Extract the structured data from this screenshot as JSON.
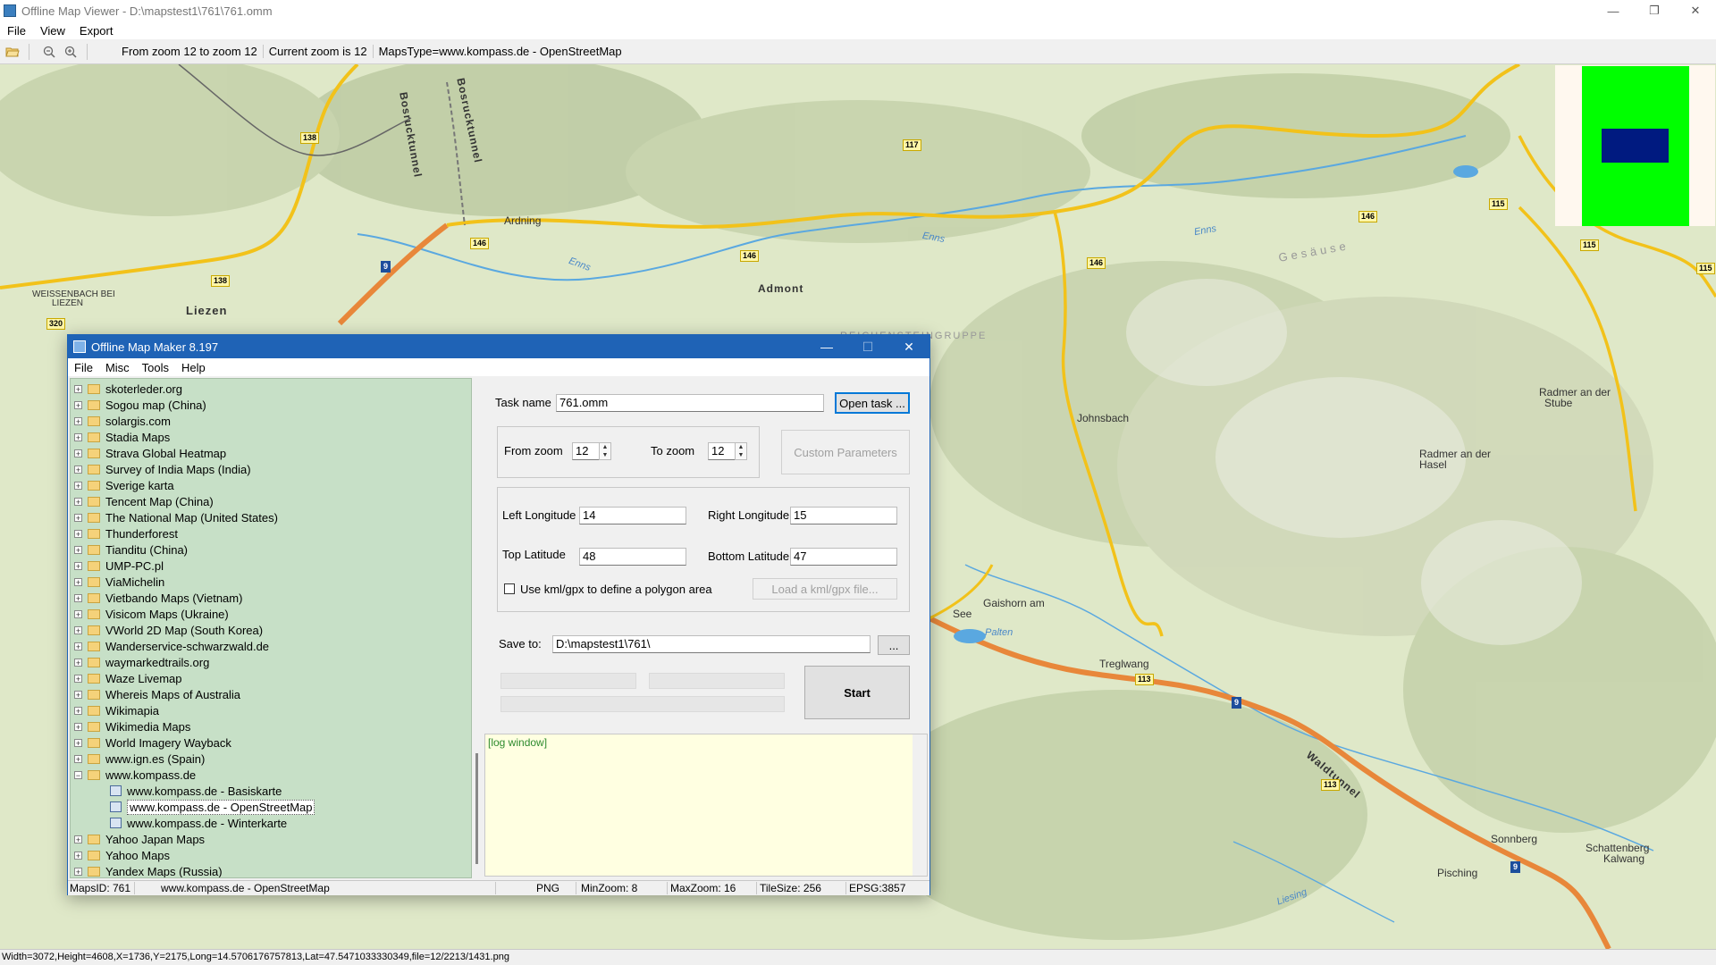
{
  "window": {
    "title": "Offline Map Viewer - D:\\mapstest1\\761\\761.omm",
    "minimize": "—",
    "maximize": "❐",
    "close": "✕"
  },
  "menu": [
    "File",
    "View",
    "Export"
  ],
  "toolbar": {
    "open_icon": "folder-open-icon",
    "zoom_range": "From zoom 12 to zoom 12",
    "current_zoom": "Current zoom is 12",
    "maps_type": "MapsType=www.kompass.de - OpenStreetMap"
  },
  "map": {
    "labels": {
      "bosrucktunnel1": "Bosrucktunnel",
      "bosrucktunnel2": "Bosrucktunnel",
      "ardning": "Ardning",
      "admont": "Admont",
      "weissenbach": "WEISSENBACH BEI",
      "liezen_small": "LIEZEN",
      "liezen": "Liezen",
      "enns1": "Enns",
      "enns2": "Enns",
      "enns3": "Enns",
      "gesause": "Gesäuse",
      "reichenstein": "REICHENSTEINGRUPPE",
      "johnsbach": "Johnsbach",
      "radmer_stube1": "Radmer an der",
      "radmer_stube2": "Stube",
      "radmer_hasel1": "Radmer an der",
      "radmer_hasel2": "Hasel",
      "gaishorn1": "Gaishorn am",
      "gaishorn2": "See",
      "palten": "Palten",
      "treglwang": "Treglwang",
      "waldtunnel": "Waldtunnel",
      "sonnberg": "Sonnberg",
      "schattenberg1": "Schattenberg",
      "schattenberg2": "Kalwang",
      "pisching": "Pisching",
      "liesing": "Liesing"
    },
    "roads": {
      "r138a": "138",
      "r138b": "138",
      "r117": "117",
      "r146a": "146",
      "r146b": "146",
      "r146c": "146",
      "r146d": "146",
      "r115a": "115",
      "r115b": "115",
      "r115c": "115",
      "r320": "320",
      "r113a": "113",
      "r113b": "113",
      "a9a": "9",
      "a9b": "9",
      "a9c": "9"
    },
    "colors": {
      "terrain": "#dfe8c8",
      "main_road": "#f2c21a",
      "motorway": "#e8873a",
      "river": "#5aa8e0"
    }
  },
  "status_bar": "Width=3072,Height=4608,X=1736,Y=2175,Long=14.5706176757813,Lat=47.5471033330349,file=12/2213/1431.png",
  "dialog": {
    "title": "Offline Map Maker 8.197",
    "minimize": "—",
    "maximize": "☐",
    "close": "✕",
    "menu": [
      "File",
      "Misc",
      "Tools",
      "Help"
    ],
    "tree": [
      {
        "label": "skoterleder.org",
        "type": "folder"
      },
      {
        "label": "Sogou map (China)",
        "type": "folder"
      },
      {
        "label": "solargis.com",
        "type": "folder"
      },
      {
        "label": "Stadia Maps",
        "type": "folder"
      },
      {
        "label": "Strava Global Heatmap",
        "type": "folder"
      },
      {
        "label": "Survey of India Maps (India)",
        "type": "folder"
      },
      {
        "label": "Sverige karta",
        "type": "folder"
      },
      {
        "label": "Tencent Map (China)",
        "type": "folder"
      },
      {
        "label": "The National Map (United States)",
        "type": "folder"
      },
      {
        "label": "Thunderforest",
        "type": "folder"
      },
      {
        "label": "Tianditu (China)",
        "type": "folder"
      },
      {
        "label": "UMP-PC.pl",
        "type": "folder"
      },
      {
        "label": "ViaMichelin",
        "type": "folder"
      },
      {
        "label": "Vietbando Maps (Vietnam)",
        "type": "folder"
      },
      {
        "label": "Visicom Maps (Ukraine)",
        "type": "folder"
      },
      {
        "label": "VWorld 2D Map (South Korea)",
        "type": "folder"
      },
      {
        "label": "Wanderservice-schwarzwald.de",
        "type": "folder"
      },
      {
        "label": "waymarkedtrails.org",
        "type": "folder"
      },
      {
        "label": "Waze Livemap",
        "type": "folder"
      },
      {
        "label": "Whereis Maps of Australia",
        "type": "folder"
      },
      {
        "label": "Wikimapia",
        "type": "folder"
      },
      {
        "label": "Wikimedia Maps",
        "type": "folder"
      },
      {
        "label": "World Imagery Wayback",
        "type": "folder"
      },
      {
        "label": "www.ign.es (Spain)",
        "type": "folder"
      },
      {
        "label": "www.kompass.de",
        "type": "folder-open"
      },
      {
        "label": "www.kompass.de - Basiskarte",
        "type": "map"
      },
      {
        "label": "www.kompass.de - OpenStreetMap",
        "type": "map",
        "selected": true
      },
      {
        "label": "www.kompass.de - Winterkarte",
        "type": "map"
      },
      {
        "label": "Yahoo Japan Maps",
        "type": "folder"
      },
      {
        "label": "Yahoo Maps",
        "type": "folder"
      },
      {
        "label": "Yandex Maps (Russia)",
        "type": "folder"
      }
    ],
    "form": {
      "task_name_label": "Task name",
      "task_name_value": "761.omm",
      "open_task": "Open task ...",
      "from_zoom_label": "From zoom",
      "from_zoom_value": "12",
      "to_zoom_label": "To zoom",
      "to_zoom_value": "12",
      "custom_params": "Custom Parameters",
      "left_lon_label": "Left Longitude",
      "left_lon_value": "14",
      "right_lon_label": "Right Longitude",
      "right_lon_value": "15",
      "top_lat_label": "Top Latitude",
      "top_lat_value": "48",
      "bottom_lat_label": "Bottom Latitude",
      "bottom_lat_value": "47",
      "kml_checkbox_label": "Use kml/gpx to define a polygon area",
      "kml_checked": false,
      "load_kml": "Load a kml/gpx file...",
      "save_to_label": "Save to:",
      "save_to_value": "D:\\mapstest1\\761\\",
      "browse": "...",
      "start": "Start"
    },
    "log": "[log window]",
    "status": {
      "maps_id": "MapsID: 761",
      "maps_name": "www.kompass.de - OpenStreetMap",
      "format": "PNG",
      "min_zoom": "MinZoom: 8",
      "max_zoom": "MaxZoom: 16",
      "tile_size": "TileSize: 256",
      "epsg": "EPSG:3857"
    }
  }
}
